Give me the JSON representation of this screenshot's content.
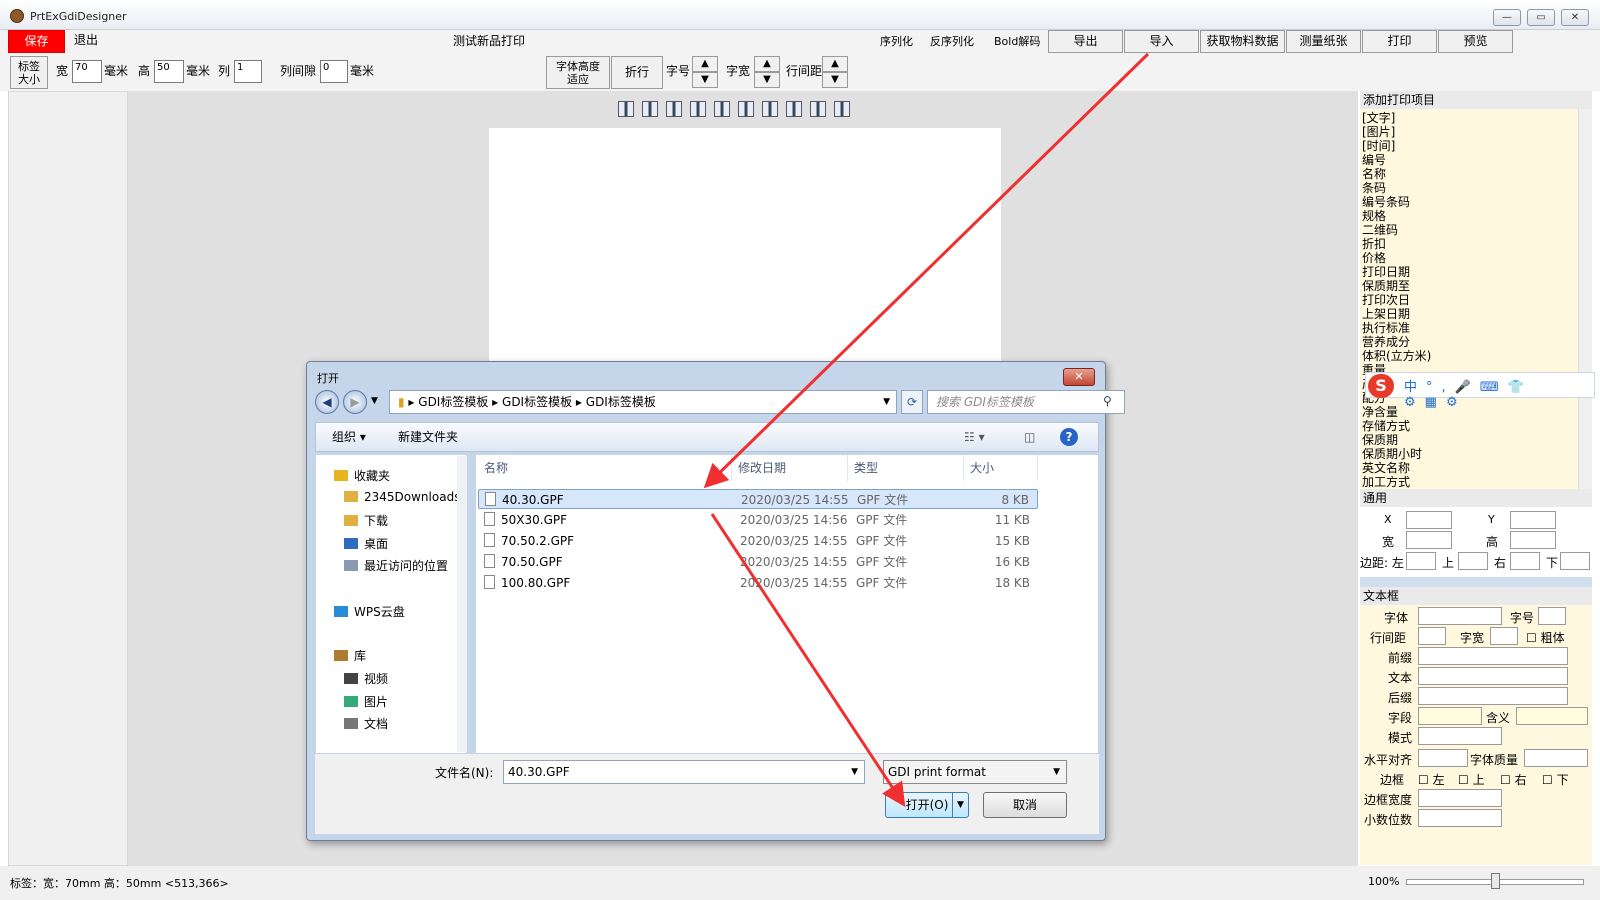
{
  "window": {
    "title": "PrtExGdiDesigner",
    "min": "—",
    "max": "▭",
    "close": "✕"
  },
  "toolbar1": {
    "save": "保存",
    "exit": "退出",
    "center_title": "测试新品打印",
    "serialize": "序列化",
    "deserialize": "反序列化",
    "bold_decode": "Bold解码",
    "export": "导出",
    "import": "导入",
    "get_material": "获取物料数据",
    "measure_paper": "测量纸张",
    "print": "打印",
    "preview": "预览"
  },
  "toolbar2": {
    "label_size": "标签\n大小",
    "width_label": "宽",
    "width_value": "70",
    "unit1": "毫米",
    "height_label": "高",
    "height_value": "50",
    "unit2": "毫米",
    "col_label": "列",
    "col_value": "1",
    "gap_label": "列间隙",
    "gap_value": "0",
    "unit3": "毫米",
    "font_fit": "字体高度\n适应",
    "wrap": "折行",
    "font_size": "字号",
    "char_width": "字宽",
    "line_spacing": "行间距"
  },
  "right_panel": {
    "add_print_header": "添加打印项目",
    "items": [
      "[文字]",
      "[图片]",
      "[时间]",
      "编号",
      "名称",
      "条码",
      "编号条码",
      "规格",
      "二维码",
      "折扣",
      "价格",
      "打印日期",
      "保质期至",
      "打印次日",
      "上架日期",
      "执行标准",
      "营养成分",
      "体积(立方米)",
      "重量",
      "产地",
      "配方",
      "净含量",
      "存储方式",
      "保质期",
      "保质期小时",
      "英文名称",
      "加工方式"
    ],
    "ime_toolbar": [
      "中",
      "°,",
      "🎤",
      "⌨",
      "👕",
      "⚙",
      "▦",
      "⚙"
    ],
    "general_header": "通用",
    "x": "X",
    "y": "Y",
    "w": "宽",
    "h": "高",
    "margin": "边距: 左",
    "top": "上",
    "right": "右",
    "bottom": "下",
    "textbox_header": "文本框",
    "font": "字体",
    "fontsize": "字号",
    "linespacing": "行间距",
    "charwidth": "字宽",
    "bold": "粗体",
    "prefix": "前缀",
    "text": "文本",
    "suffix": "后缀",
    "field": "字段",
    "meaning": "含义",
    "mode": "模式",
    "halign": "水平对齐",
    "quality": "字体质量",
    "border": "边框",
    "bleft": "左",
    "btop": "上",
    "bright": "右",
    "bbottom": "下",
    "border_width": "边框宽度",
    "decimals": "小数位数"
  },
  "status": {
    "label": "标签：宽：70mm 高：50mm  <513,366>",
    "zoom": "100%"
  },
  "dialog": {
    "title": "打开",
    "breadcrumb": [
      "GDI标签模板",
      "GDI标签模板",
      "GDI标签模板"
    ],
    "search_placeholder": "搜索 GDI标签模板",
    "organize": "组织 ▾",
    "new_folder": "新建文件夹",
    "nav": [
      {
        "label": "收藏夹",
        "type": "star"
      },
      {
        "label": "2345Downloads",
        "type": "folder"
      },
      {
        "label": "下载",
        "type": "folder"
      },
      {
        "label": "桌面",
        "type": "desktop"
      },
      {
        "label": "最近访问的位置",
        "type": "recent"
      },
      {
        "label": "WPS云盘",
        "type": "cloud"
      },
      {
        "label": "库",
        "type": "lib"
      },
      {
        "label": "视频",
        "type": "video"
      },
      {
        "label": "图片",
        "type": "pic"
      },
      {
        "label": "文档",
        "type": "doc"
      }
    ],
    "columns": [
      "名称",
      "修改日期",
      "类型",
      "大小"
    ],
    "files": [
      {
        "name": "40.30.GPF",
        "date": "2020/03/25 14:55",
        "type": "GPF 文件",
        "size": "8 KB",
        "selected": true
      },
      {
        "name": "50X30.GPF",
        "date": "2020/03/25 14:56",
        "type": "GPF 文件",
        "size": "11 KB"
      },
      {
        "name": "70.50.2.GPF",
        "date": "2020/03/25 14:55",
        "type": "GPF 文件",
        "size": "15 KB"
      },
      {
        "name": "70.50.GPF",
        "date": "2020/03/25 14:55",
        "type": "GPF 文件",
        "size": "16 KB"
      },
      {
        "name": "100.80.GPF",
        "date": "2020/03/25 14:55",
        "type": "GPF 文件",
        "size": "18 KB"
      }
    ],
    "filename_label": "文件名(N):",
    "filename_value": "40.30.GPF",
    "filetype": "GDI print format",
    "open": "打开(O)",
    "cancel": "取消"
  },
  "colors": {
    "save_bg": "#ff0000",
    "arrow": "#f03030",
    "selection": "#d6e6fb"
  }
}
